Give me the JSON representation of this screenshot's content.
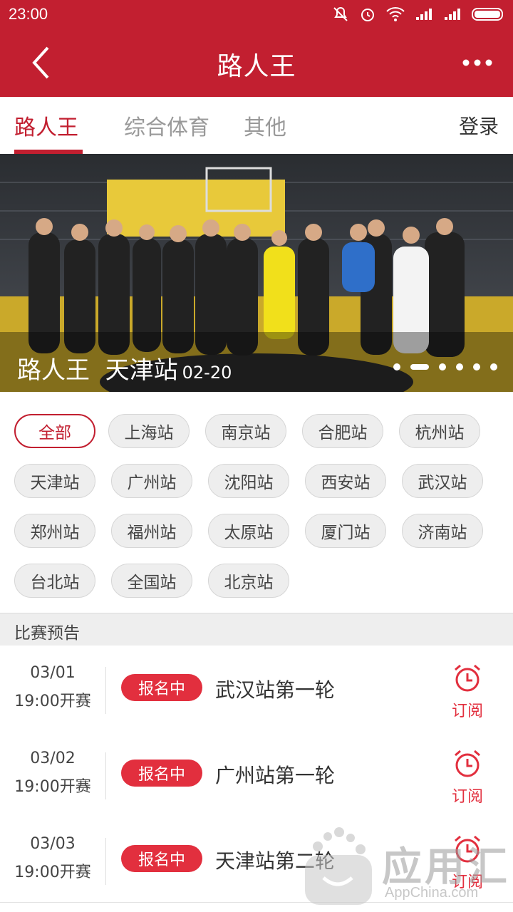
{
  "status_bar": {
    "time": "23:00"
  },
  "app_bar": {
    "title": "路人王",
    "back_icon": "back-arrow-icon",
    "more_icon": "more-dots-icon"
  },
  "tabs": [
    {
      "label": "路人王",
      "active": true
    },
    {
      "label": "综合体育",
      "active": false
    },
    {
      "label": "其他",
      "active": false
    }
  ],
  "login_label": "登录",
  "banner": {
    "title": "路人王  天津站",
    "date": "02-20",
    "dots_total": 6,
    "dots_active_index": 1
  },
  "filters": [
    {
      "label": "全部",
      "active": true
    },
    {
      "label": "上海站"
    },
    {
      "label": "南京站"
    },
    {
      "label": "合肥站"
    },
    {
      "label": "杭州站"
    },
    {
      "label": "天津站"
    },
    {
      "label": "广州站"
    },
    {
      "label": "沈阳站"
    },
    {
      "label": "西安站"
    },
    {
      "label": "武汉站"
    },
    {
      "label": "郑州站"
    },
    {
      "label": "福州站"
    },
    {
      "label": "太原站"
    },
    {
      "label": "厦门站"
    },
    {
      "label": "济南站"
    },
    {
      "label": "台北站"
    },
    {
      "label": "全国站"
    },
    {
      "label": "北京站"
    }
  ],
  "section_title": "比赛预告",
  "matches": [
    {
      "date": "03/01",
      "time": "19:00开赛",
      "status": "报名中",
      "name": "武汉站第一轮",
      "subscribe": "订阅"
    },
    {
      "date": "03/02",
      "time": "19:00开赛",
      "status": "报名中",
      "name": "广州站第一轮",
      "subscribe": "订阅"
    },
    {
      "date": "03/03",
      "time": "19:00开赛",
      "status": "报名中",
      "name": "天津站第二轮",
      "subscribe": "订阅"
    }
  ],
  "watermark": {
    "brand": "应用汇",
    "url": "AppChina.com"
  },
  "colors": {
    "primary": "#c21f30",
    "badge": "#e22f3e"
  }
}
